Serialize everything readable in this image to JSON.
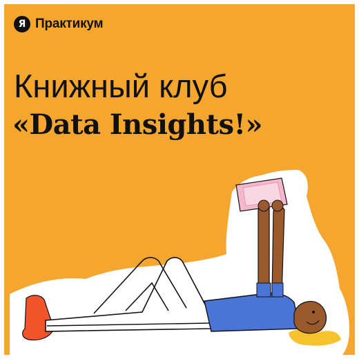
{
  "brand": {
    "logo_glyph": "Я",
    "name": "Практикум"
  },
  "headline": {
    "line1": "Книжный клуб",
    "line2": "«Data Insights!»"
  },
  "illustration": {
    "subject": "person-lying-reading-book-icon"
  },
  "colors": {
    "background": "#F4A62E",
    "text": "#111111",
    "book": "#F4B8CE",
    "shirt": "#4A74D6",
    "skin": "#9A5A2E",
    "hair": "#F6C22E",
    "shoe": "#F2552B"
  }
}
